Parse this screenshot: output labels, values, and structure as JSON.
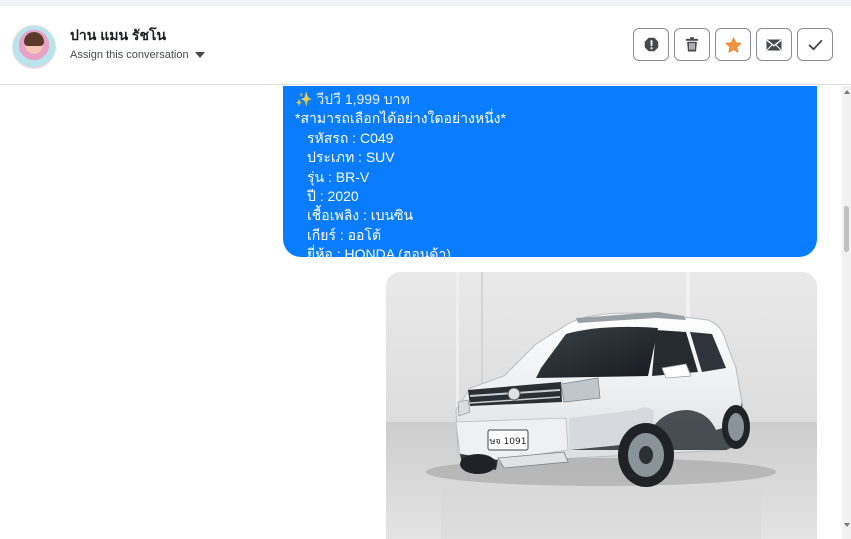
{
  "header": {
    "contact_name": "ปาน แมน รัชโน",
    "assign_label": "Assign this conversation",
    "actions": [
      {
        "name": "report-icon",
        "color": "#444950"
      },
      {
        "name": "trash-icon",
        "color": "#444950"
      },
      {
        "name": "star-icon",
        "color": "#f5923e"
      },
      {
        "name": "envelope-icon",
        "color": "#444950"
      },
      {
        "name": "checkmark-icon",
        "color": "#444950"
      }
    ]
  },
  "message": {
    "bubble_color": "#0a7cff",
    "partial_top": "✨ วีปวี 1,999 บาท",
    "note": "*สามารถเลือกได้อย่างใดอย่างหนึ่ง*",
    "details": [
      "รหัสรถ : C049",
      "ประเภท : SUV",
      "รุ่น : BR-V",
      "ปี : 2020",
      "เชื้อเพลิง : เบนซิน",
      "เกียร์ : ออโต้",
      "ยี่ห้อ : HONDA (ฮอนด้า)"
    ]
  },
  "photo": {
    "subject": "white-honda-brv-suv",
    "plate_text": "ษจ 1091"
  }
}
